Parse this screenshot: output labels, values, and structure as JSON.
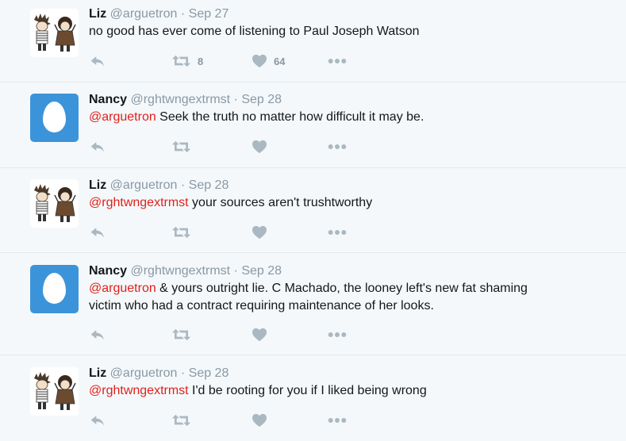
{
  "tweets": [
    {
      "name": "Liz",
      "handle": "@arguetron",
      "separator": "·",
      "date": "Sep 27",
      "mention": "",
      "text": "no good has ever come of listening to Paul Joseph Watson",
      "text2": "",
      "retweet_count": "8",
      "like_count": "64",
      "avatar": "calvin-and-hobbes-cartoon"
    },
    {
      "name": "Nancy",
      "handle": "@rghtwngextrmst",
      "separator": "·",
      "date": "Sep 28",
      "mention": "@arguetron",
      "text": " Seek the truth no matter how difficult it may be.",
      "text2": "",
      "retweet_count": "",
      "like_count": "",
      "avatar": "default-egg"
    },
    {
      "name": "Liz",
      "handle": "@arguetron",
      "separator": "·",
      "date": "Sep 28",
      "mention": "@rghtwngextrmst",
      "text": " your sources aren't trushtworthy",
      "text2": "",
      "retweet_count": "",
      "like_count": "",
      "avatar": "calvin-and-hobbes-cartoon"
    },
    {
      "name": "Nancy",
      "handle": "@rghtwngextrmst",
      "separator": "·",
      "date": "Sep 28",
      "mention": "@arguetron",
      "text": " & yours outright lie. C Machado, the looney left's new fat shaming",
      "text2": "victim who had a contract requiring maintenance of her looks.",
      "retweet_count": "",
      "like_count": "",
      "avatar": "default-egg"
    },
    {
      "name": "Liz",
      "handle": "@arguetron",
      "separator": "·",
      "date": "Sep 28",
      "mention": "@rghtwngextrmst",
      "text": " I'd be rooting for you if I liked being wrong",
      "text2": "",
      "retweet_count": "",
      "like_count": "",
      "avatar": "calvin-and-hobbes-cartoon"
    }
  ],
  "colors": {
    "background": "#f5f8fa",
    "mention": "#e0211b",
    "meta": "#8899a6",
    "icon": "#aab8c2",
    "egg_bg": "#3b94d9"
  },
  "icons": [
    "reply-icon",
    "retweet-icon",
    "like-icon",
    "more-icon"
  ]
}
